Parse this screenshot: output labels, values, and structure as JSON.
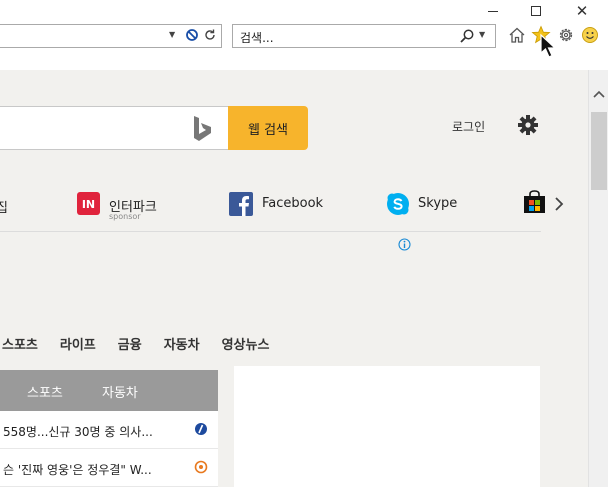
{
  "browser": {
    "search_box_text": "검색...",
    "window_controls": [
      "minimize",
      "maximize",
      "close"
    ],
    "toolbar_icons": [
      "home-icon",
      "favorites-star-icon",
      "tools-gear-icon",
      "feedback-smiley-icon"
    ]
  },
  "bing": {
    "search_button_label": "웹 검색",
    "login_label": "로그인"
  },
  "tiles": [
    {
      "label": "집",
      "sub": ""
    },
    {
      "label": "인터파크",
      "sub": "sponsor",
      "icon_text": "IN"
    },
    {
      "label": "Facebook",
      "sub": ""
    },
    {
      "label": "Skype",
      "sub": ""
    },
    {
      "label": "",
      "sub": ""
    }
  ],
  "categories": [
    "스포츠",
    "라이프",
    "금융",
    "자동차",
    "영상뉴스"
  ],
  "news_tabs": [
    "스포츠",
    "자동차"
  ],
  "news": [
    {
      "title": "558명...신규 30명 중 의사..."
    },
    {
      "title": "슨 '진짜 영웅'은 정우결\" W..."
    }
  ],
  "colors": {
    "accent": "#f7b42c",
    "page_bg": "#f2f1ee",
    "tab_bar": "#9a9a9a",
    "interpark": "#e0233c",
    "facebook": "#3b5998",
    "skype": "#00aff0"
  }
}
